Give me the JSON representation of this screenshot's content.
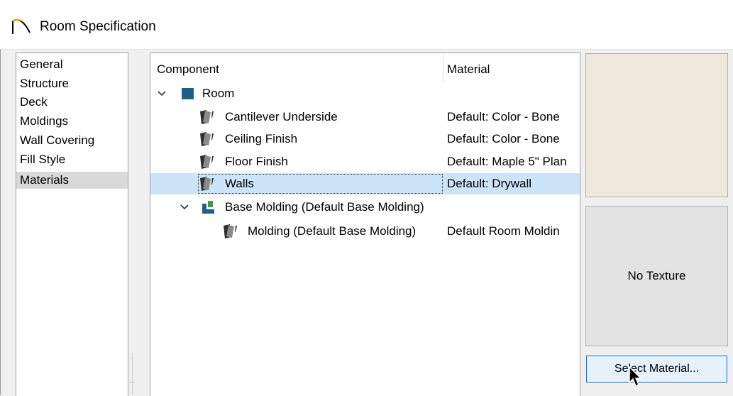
{
  "window": {
    "title": "Room Specification",
    "title_icon": "arch-icon"
  },
  "nav": {
    "items": [
      {
        "label": "General"
      },
      {
        "label": "Structure"
      },
      {
        "label": "Deck"
      },
      {
        "label": "Moldings"
      },
      {
        "label": "Wall Covering"
      },
      {
        "label": "Fill Style"
      },
      {
        "label": "Materials",
        "selected": true
      }
    ]
  },
  "tree": {
    "columns": [
      "Component",
      "Material"
    ],
    "rows": [
      {
        "component": "Room",
        "material": "",
        "expanded": true,
        "icon": "room-square-icon"
      },
      {
        "component": "Cantilever Underside",
        "material": "Default: Color - Bone",
        "icon": "material-swatch-icon"
      },
      {
        "component": "Ceiling Finish",
        "material": "Default: Color - Bone",
        "icon": "material-swatch-icon"
      },
      {
        "component": "Floor Finish",
        "material": "Default: Maple 5\" Plan",
        "icon": "material-swatch-icon"
      },
      {
        "component": "Walls",
        "material": "Default: Drywall",
        "icon": "material-swatch-icon",
        "selected": true
      },
      {
        "component": "Base Molding (Default Base Molding)",
        "material": "",
        "expanded": true,
        "icon": "molding-profile-icon"
      },
      {
        "component": "Molding (Default Base Molding)",
        "material": "Default Room Moldin",
        "icon": "material-swatch-icon"
      }
    ]
  },
  "preview": {
    "color_swatch": "#eee8dc",
    "texture_label": "No Texture"
  },
  "buttons": {
    "select_material": "Select Material..."
  },
  "colors": {
    "selection": "#cce4f7",
    "accent": "#0078d7",
    "room_icon": "#1d5f86"
  }
}
